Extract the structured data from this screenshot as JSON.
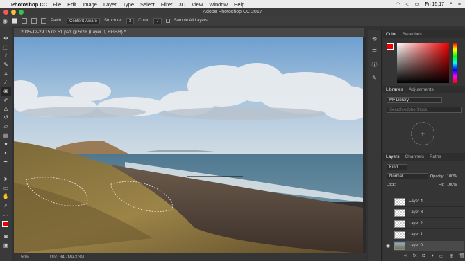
{
  "menubar": {
    "app": "Photoshop CC",
    "items": [
      "File",
      "Edit",
      "Image",
      "Layer",
      "Type",
      "Select",
      "Filter",
      "3D",
      "View",
      "Window",
      "Help"
    ],
    "clock": "Fri 15:17"
  },
  "window": {
    "title": "Adobe Photoshop CC 2017"
  },
  "options": {
    "patch_label": "Patch:",
    "patch_value": "Content-Aware",
    "structure_label": "Structure:",
    "structure_value": "3",
    "color_label": "Color:",
    "color_value": "7",
    "sample_all": "Sample All Layers"
  },
  "document": {
    "tab": "2015-12-29 15.03.51.psd @ 50% (Layer 0, RGB/8) *"
  },
  "status": {
    "zoom": "50%",
    "doc": "Doc: 34.7M/43.3M"
  },
  "color_panel": {
    "tabs": [
      "Color",
      "Swatches"
    ]
  },
  "libraries": {
    "tabs": [
      "Libraries",
      "Adjustments"
    ],
    "library": "My Library",
    "search_placeholder": "Search Adobe Stock"
  },
  "layers": {
    "tabs": [
      "Layers",
      "Channels",
      "Paths"
    ],
    "kind": "Kind",
    "blend": "Normal",
    "opacity_label": "Opacity:",
    "opacity": "100%",
    "lock_label": "Lock:",
    "fill_label": "Fill:",
    "fill": "100%",
    "items": [
      "Layer 4",
      "Layer 3",
      "Layer 2",
      "Layer 1",
      "Layer 0"
    ]
  }
}
